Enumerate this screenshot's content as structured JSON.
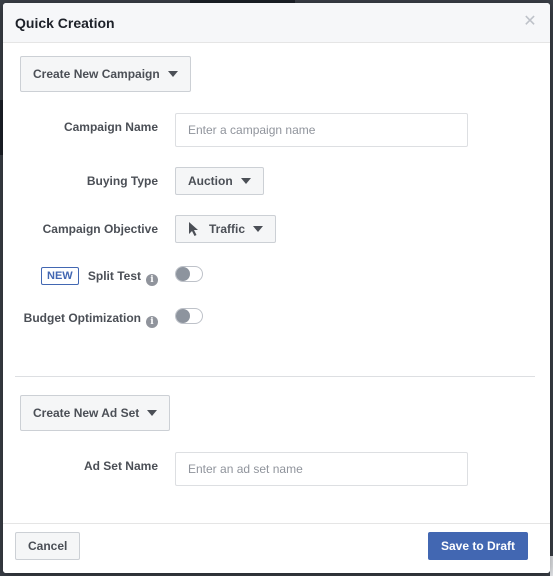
{
  "dialog": {
    "title": "Quick Creation",
    "close_icon": "close-icon"
  },
  "campaign": {
    "section_button": "Create New Campaign",
    "name_label": "Campaign Name",
    "name_placeholder": "Enter a campaign name",
    "name_value": "",
    "buying_type_label": "Buying Type",
    "buying_type_value": "Auction",
    "objective_label": "Campaign Objective",
    "objective_value": "Traffic",
    "objective_icon": "cursor-arrow-icon",
    "new_badge": "NEW",
    "split_test_label": "Split Test",
    "split_test_on": false,
    "budget_optimization_label": "Budget Optimization",
    "budget_optimization_on": false
  },
  "ad_set": {
    "section_button": "Create New Ad Set",
    "name_label": "Ad Set Name",
    "name_placeholder": "Enter an ad set name",
    "name_value": ""
  },
  "footer": {
    "cancel_label": "Cancel",
    "save_label": "Save to Draft"
  },
  "colors": {
    "primary": "#4267b2",
    "text": "#4b4f56",
    "border": "#ccd0d5",
    "toggle_off": "#8d949e"
  }
}
